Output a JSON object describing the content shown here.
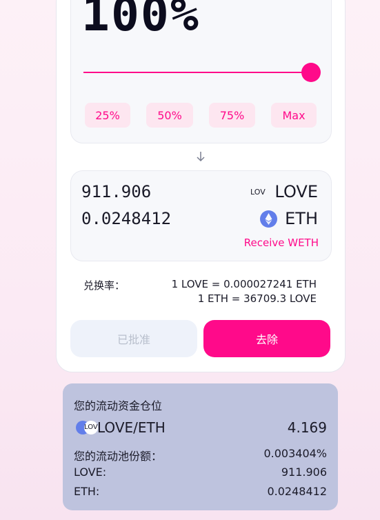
{
  "amount": {
    "percent_display": "100%",
    "slider_percent": 100
  },
  "quick_buttons": [
    "25%",
    "50%",
    "75%",
    "Max"
  ],
  "outputs": [
    {
      "amount": "911.906",
      "token": "LOVE",
      "logo_text": "LOV"
    },
    {
      "amount": "0.0248412",
      "token": "ETH"
    }
  ],
  "receive_link": "Receive WETH",
  "rate": {
    "label": "兑换率：",
    "line1": "1 LOVE = 0.000027241 ETH",
    "line2": "1 ETH = 36709.3 LOVE"
  },
  "buttons": {
    "approved": "已批准",
    "remove": "去除"
  },
  "position": {
    "title": "您的流动资金仓位",
    "pair_logo_text": "LOV",
    "pair": "LOVE/ETH",
    "pair_value": "4.169",
    "rows": [
      {
        "label": "您的流动池份额：",
        "value": "0.003404%"
      },
      {
        "label": "LOVE:",
        "value": "911.906"
      },
      {
        "label": "ETH:",
        "value": "0.0248412"
      }
    ]
  },
  "colors": {
    "accent": "#ff0a8a",
    "eth": "#627eea",
    "position_bg": "#bec3de"
  }
}
